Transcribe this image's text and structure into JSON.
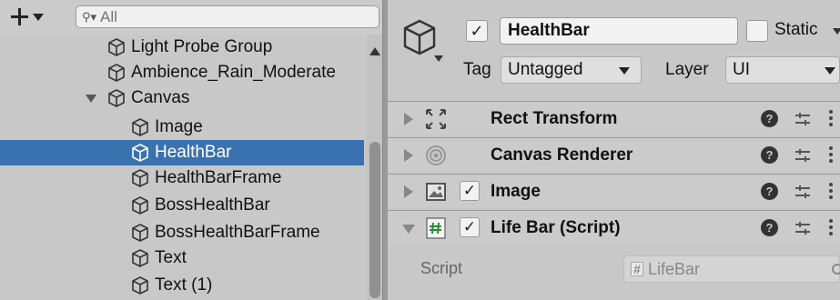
{
  "hierarchy": {
    "search_placeholder": "All",
    "items": [
      {
        "label": "Light Probe Group",
        "selected": false,
        "expanded": null
      },
      {
        "label": "Ambience_Rain_Moderate",
        "selected": false,
        "expanded": null
      },
      {
        "label": "Canvas",
        "selected": false,
        "expanded": true
      },
      {
        "label": "Image",
        "selected": false,
        "expanded": null
      },
      {
        "label": "HealthBar",
        "selected": true,
        "expanded": null
      },
      {
        "label": "HealthBarFrame",
        "selected": false,
        "expanded": null
      },
      {
        "label": "BossHealthBar",
        "selected": false,
        "expanded": null
      },
      {
        "label": "BossHealthBarFrame",
        "selected": false,
        "expanded": null
      },
      {
        "label": "Text",
        "selected": false,
        "expanded": null
      },
      {
        "label": "Text (1)",
        "selected": false,
        "expanded": null
      }
    ]
  },
  "inspector": {
    "object_name": "HealthBar",
    "active": true,
    "static_label": "Static",
    "tag_label": "Tag",
    "tag_value": "Untagged",
    "layer_label": "Layer",
    "layer_value": "UI",
    "components": [
      {
        "name": "Rect Transform",
        "icon": "rect-transform-icon",
        "has_checkbox": false,
        "expanded": false
      },
      {
        "name": "Canvas Renderer",
        "icon": "canvas-renderer-icon",
        "has_checkbox": false,
        "expanded": false
      },
      {
        "name": "Image",
        "icon": "image-icon",
        "has_checkbox": true,
        "checked": true,
        "expanded": false
      },
      {
        "name": "Life Bar (Script)",
        "icon": "script-icon",
        "has_checkbox": true,
        "checked": true,
        "expanded": true
      }
    ],
    "script_label": "Script",
    "script_value": "LifeBar"
  },
  "colors": {
    "panel_bg": "#c8c8c8",
    "selection": "#3a72b0",
    "field_bg": "#f2f2f2"
  }
}
